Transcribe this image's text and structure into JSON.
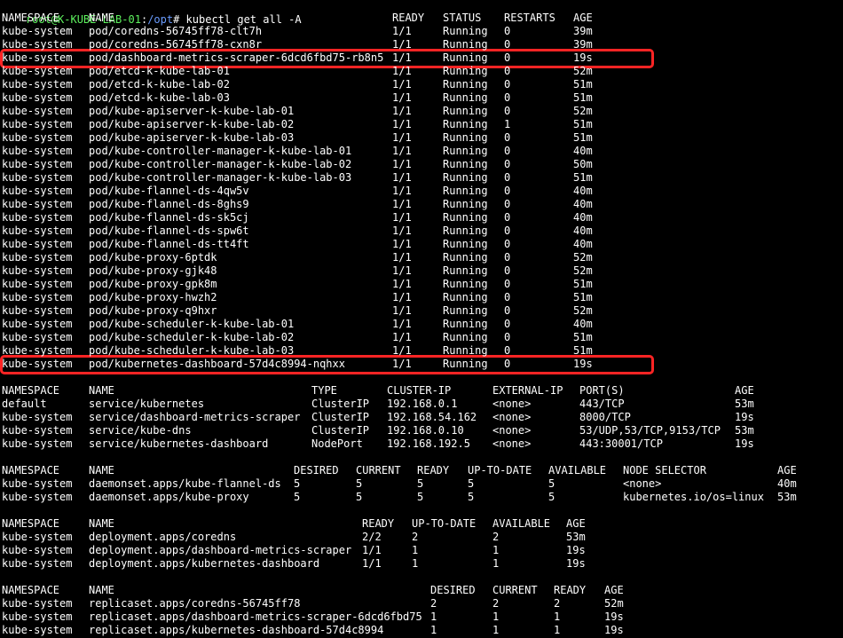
{
  "prompt": {
    "user_host": "root@K-KUBE-LAB-01",
    "separator": ":",
    "path": "/opt",
    "symbol": "# ",
    "command": "kubectl get all -A"
  },
  "pods": {
    "headers": [
      "NAMESPACE",
      "NAME",
      "READY",
      "STATUS",
      "RESTARTS",
      "AGE"
    ],
    "rows": [
      [
        "kube-system",
        "pod/coredns-56745ff78-clt7h",
        "1/1",
        "Running",
        "0",
        "39m"
      ],
      [
        "kube-system",
        "pod/coredns-56745ff78-cxn8r",
        "1/1",
        "Running",
        "0",
        "39m"
      ],
      [
        "kube-system",
        "pod/dashboard-metrics-scraper-6dcd6fbd75-rb8n5",
        "1/1",
        "Running",
        "0",
        "19s"
      ],
      [
        "kube-system",
        "pod/etcd-k-kube-lab-01",
        "1/1",
        "Running",
        "0",
        "52m"
      ],
      [
        "kube-system",
        "pod/etcd-k-kube-lab-02",
        "1/1",
        "Running",
        "0",
        "51m"
      ],
      [
        "kube-system",
        "pod/etcd-k-kube-lab-03",
        "1/1",
        "Running",
        "0",
        "51m"
      ],
      [
        "kube-system",
        "pod/kube-apiserver-k-kube-lab-01",
        "1/1",
        "Running",
        "0",
        "52m"
      ],
      [
        "kube-system",
        "pod/kube-apiserver-k-kube-lab-02",
        "1/1",
        "Running",
        "1",
        "51m"
      ],
      [
        "kube-system",
        "pod/kube-apiserver-k-kube-lab-03",
        "1/1",
        "Running",
        "0",
        "51m"
      ],
      [
        "kube-system",
        "pod/kube-controller-manager-k-kube-lab-01",
        "1/1",
        "Running",
        "0",
        "40m"
      ],
      [
        "kube-system",
        "pod/kube-controller-manager-k-kube-lab-02",
        "1/1",
        "Running",
        "0",
        "50m"
      ],
      [
        "kube-system",
        "pod/kube-controller-manager-k-kube-lab-03",
        "1/1",
        "Running",
        "0",
        "51m"
      ],
      [
        "kube-system",
        "pod/kube-flannel-ds-4qw5v",
        "1/1",
        "Running",
        "0",
        "40m"
      ],
      [
        "kube-system",
        "pod/kube-flannel-ds-8ghs9",
        "1/1",
        "Running",
        "0",
        "40m"
      ],
      [
        "kube-system",
        "pod/kube-flannel-ds-sk5cj",
        "1/1",
        "Running",
        "0",
        "40m"
      ],
      [
        "kube-system",
        "pod/kube-flannel-ds-spw6t",
        "1/1",
        "Running",
        "0",
        "40m"
      ],
      [
        "kube-system",
        "pod/kube-flannel-ds-tt4ft",
        "1/1",
        "Running",
        "0",
        "40m"
      ],
      [
        "kube-system",
        "pod/kube-proxy-6ptdk",
        "1/1",
        "Running",
        "0",
        "52m"
      ],
      [
        "kube-system",
        "pod/kube-proxy-gjk48",
        "1/1",
        "Running",
        "0",
        "52m"
      ],
      [
        "kube-system",
        "pod/kube-proxy-gpk8m",
        "1/1",
        "Running",
        "0",
        "51m"
      ],
      [
        "kube-system",
        "pod/kube-proxy-hwzh2",
        "1/1",
        "Running",
        "0",
        "51m"
      ],
      [
        "kube-system",
        "pod/kube-proxy-q9hxr",
        "1/1",
        "Running",
        "0",
        "52m"
      ],
      [
        "kube-system",
        "pod/kube-scheduler-k-kube-lab-01",
        "1/1",
        "Running",
        "0",
        "40m"
      ],
      [
        "kube-system",
        "pod/kube-scheduler-k-kube-lab-02",
        "1/1",
        "Running",
        "0",
        "51m"
      ],
      [
        "kube-system",
        "pod/kube-scheduler-k-kube-lab-03",
        "1/1",
        "Running",
        "0",
        "51m"
      ],
      [
        "kube-system",
        "pod/kubernetes-dashboard-57d4c8994-nqhxx",
        "1/1",
        "Running",
        "0",
        "19s"
      ]
    ]
  },
  "services": {
    "headers": [
      "NAMESPACE",
      "NAME",
      "TYPE",
      "CLUSTER-IP",
      "EXTERNAL-IP",
      "PORT(S)",
      "AGE"
    ],
    "rows": [
      [
        "default",
        "service/kubernetes",
        "ClusterIP",
        "192.168.0.1",
        "<none>",
        "443/TCP",
        "53m"
      ],
      [
        "kube-system",
        "service/dashboard-metrics-scraper",
        "ClusterIP",
        "192.168.54.162",
        "<none>",
        "8000/TCP",
        "19s"
      ],
      [
        "kube-system",
        "service/kube-dns",
        "ClusterIP",
        "192.168.0.10",
        "<none>",
        "53/UDP,53/TCP,9153/TCP",
        "53m"
      ],
      [
        "kube-system",
        "service/kubernetes-dashboard",
        "NodePort",
        "192.168.192.5",
        "<none>",
        "443:30001/TCP",
        "19s"
      ]
    ]
  },
  "daemonsets": {
    "headers": [
      "NAMESPACE",
      "NAME",
      "DESIRED",
      "CURRENT",
      "READY",
      "UP-TO-DATE",
      "AVAILABLE",
      "NODE SELECTOR",
      "AGE"
    ],
    "rows": [
      [
        "kube-system",
        "daemonset.apps/kube-flannel-ds",
        "5",
        "5",
        "5",
        "5",
        "5",
        "<none>",
        "40m"
      ],
      [
        "kube-system",
        "daemonset.apps/kube-proxy",
        "5",
        "5",
        "5",
        "5",
        "5",
        "kubernetes.io/os=linux",
        "53m"
      ]
    ]
  },
  "deployments": {
    "headers": [
      "NAMESPACE",
      "NAME",
      "READY",
      "UP-TO-DATE",
      "AVAILABLE",
      "AGE"
    ],
    "rows": [
      [
        "kube-system",
        "deployment.apps/coredns",
        "2/2",
        "2",
        "2",
        "53m"
      ],
      [
        "kube-system",
        "deployment.apps/dashboard-metrics-scraper",
        "1/1",
        "1",
        "1",
        "19s"
      ],
      [
        "kube-system",
        "deployment.apps/kubernetes-dashboard",
        "1/1",
        "1",
        "1",
        "19s"
      ]
    ]
  },
  "replicasets": {
    "headers": [
      "NAMESPACE",
      "NAME",
      "DESIRED",
      "CURRENT",
      "READY",
      "AGE"
    ],
    "rows": [
      [
        "kube-system",
        "replicaset.apps/coredns-56745ff78",
        "2",
        "2",
        "2",
        "52m"
      ],
      [
        "kube-system",
        "replicaset.apps/dashboard-metrics-scraper-6dcd6fbd75",
        "1",
        "1",
        "1",
        "19s"
      ],
      [
        "kube-system",
        "replicaset.apps/kubernetes-dashboard-57d4c8994",
        "1",
        "1",
        "1",
        "19s"
      ]
    ]
  },
  "colors": {
    "background": "#000000",
    "text": "#ffffff",
    "prompt_user": "#5ef25e",
    "prompt_path": "#6a9cff",
    "highlight": "#ff2424"
  }
}
